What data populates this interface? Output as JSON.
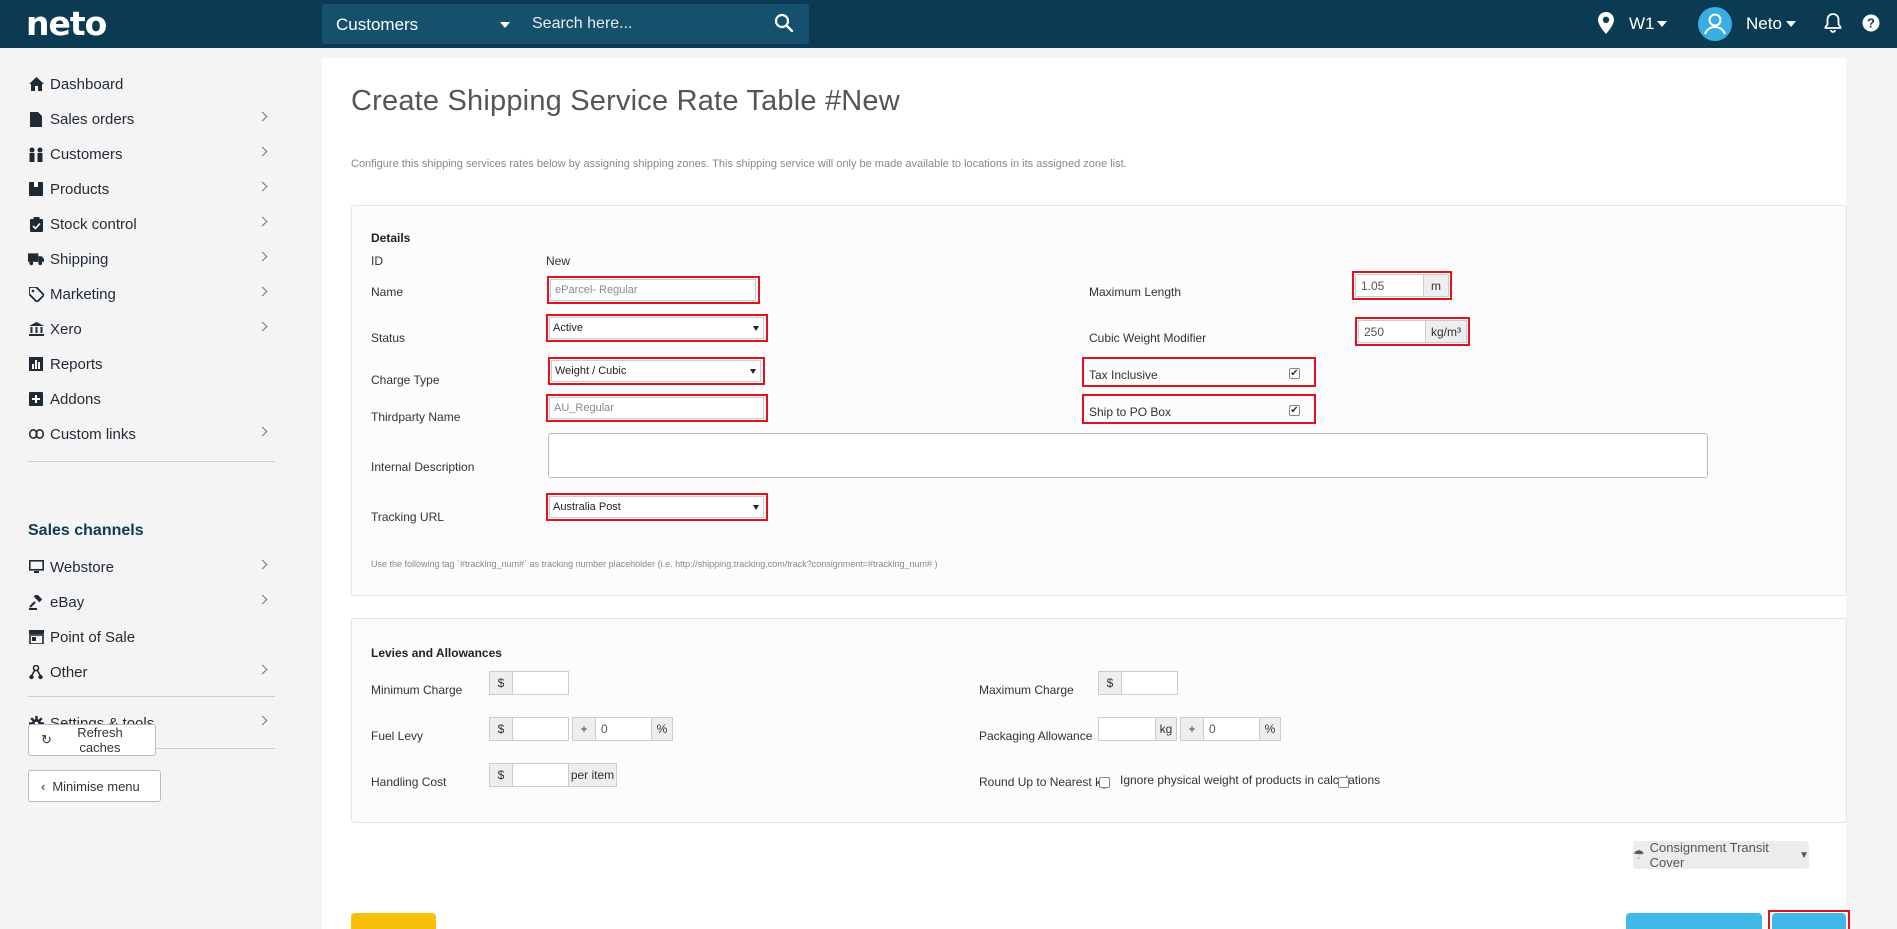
{
  "topbar": {
    "logo": "neto",
    "search_scope": "Customers",
    "search_placeholder": "Search here...",
    "store": "W1",
    "user": "Neto"
  },
  "sidebar": {
    "items": [
      {
        "label": "Dashboard",
        "icon": "home-icon"
      },
      {
        "label": "Sales orders",
        "icon": "document-icon"
      },
      {
        "label": "Customers",
        "icon": "users-icon"
      },
      {
        "label": "Products",
        "icon": "box-icon"
      },
      {
        "label": "Stock control",
        "icon": "clipboard-icon"
      },
      {
        "label": "Shipping",
        "icon": "truck-icon"
      },
      {
        "label": "Marketing",
        "icon": "tag-icon"
      },
      {
        "label": "Xero",
        "icon": "bank-icon"
      },
      {
        "label": "Reports",
        "icon": "chart-icon"
      },
      {
        "label": "Addons",
        "icon": "plus-square-icon"
      },
      {
        "label": "Custom links",
        "icon": "link-icon"
      }
    ],
    "sales_channels_heading": "Sales channels",
    "channels": [
      {
        "label": "Webstore",
        "icon": "monitor-icon"
      },
      {
        "label": "eBay",
        "icon": "gavel-icon"
      },
      {
        "label": "Point of Sale",
        "icon": "store-icon"
      },
      {
        "label": "Other",
        "icon": "network-icon"
      }
    ],
    "settings": "Settings & tools",
    "refresh_caches": "Refresh caches",
    "minimise_menu": "Minimise menu"
  },
  "page": {
    "title": "Create Shipping Service Rate Table #New",
    "description": "Configure this shipping services rates below by assigning shipping zones. This shipping service will only be made available to locations in its assigned zone list."
  },
  "details": {
    "heading": "Details",
    "id_label": "ID",
    "id_value": "New",
    "name_label": "Name",
    "name_value": "eParcel- Regular",
    "status_label": "Status",
    "status_value": "Active",
    "charge_type_label": "Charge Type",
    "charge_type_value": "Weight / Cubic",
    "thirdparty_label": "Thirdparty Name",
    "thirdparty_value": "AU_Regular",
    "internal_desc_label": "Internal Description",
    "tracking_label": "Tracking URL",
    "tracking_value": "Australia Post",
    "tracking_hint": "Use the following tag `#tracking_num#` as tracking number placeholder (i.e. http://shipping.tracking.com/track?consignment=#tracking_num# )",
    "max_length_label": "Maximum Length",
    "max_length_value": "1.05",
    "max_length_unit": "m",
    "cubic_label": "Cubic Weight Modifier",
    "cubic_value": "250",
    "cubic_unit": "kg/m³",
    "tax_label": "Tax Inclusive",
    "tax_checked": "✔",
    "po_box_label": "Ship to PO Box",
    "po_box_checked": "✔"
  },
  "levies": {
    "heading": "Levies and Allowances",
    "min_charge_label": "Minimum Charge",
    "fuel_levy_label": "Fuel Levy",
    "handling_label": "Handling Cost",
    "max_charge_label": "Maximum Charge",
    "packaging_label": "Packaging Allowance",
    "round_up_label": "Round Up to Nearest kg",
    "ignore_weight_label": "Ignore physical weight of products in calculations",
    "currency": "$",
    "plus": "+",
    "percent": "%",
    "kg": "kg",
    "per_item": "per item",
    "fuel_pct_value": "0",
    "packaging_pct_value": "0"
  },
  "consignment_button": "Consignment Transit Cover"
}
